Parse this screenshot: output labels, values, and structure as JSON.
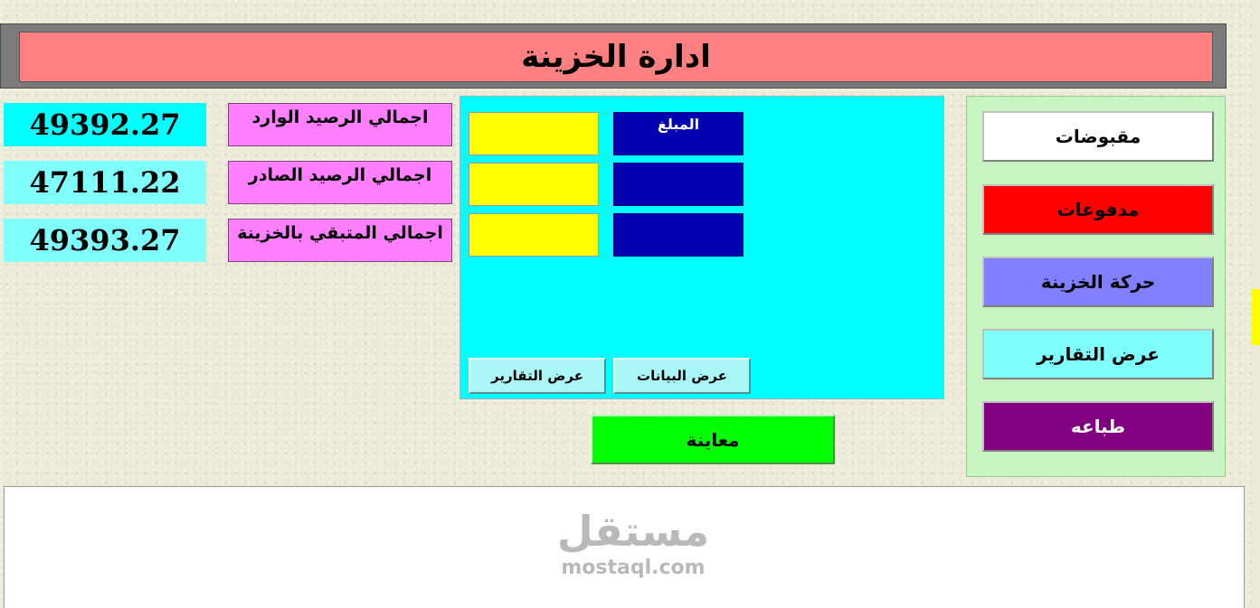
{
  "header": {
    "title": "ادارة الخزينة"
  },
  "menu": [
    {
      "label": "مقبوضات",
      "bg": "#ffffff",
      "color": "#000000"
    },
    {
      "label": "مدفوعات",
      "bg": "#ff0000",
      "color": "#000000"
    },
    {
      "label": "حركة الخزينة",
      "bg": "#8080ff",
      "color": "#000000"
    },
    {
      "label": "عرض التقارير",
      "bg": "#80ffff",
      "color": "#000000"
    },
    {
      "label": "طباعه",
      "bg": "#800080",
      "color": "#ffffff"
    }
  ],
  "center": {
    "amount_label": "المبلغ",
    "show_data_button": "عرض البيانات",
    "show_reports_button": "عرض التقارير"
  },
  "preview_button": "معاينة",
  "totals": [
    {
      "label": "اجمالي الرصيد الوارد",
      "value": "49392.27"
    },
    {
      "label": "اجمالي الرصيد الصادر",
      "value": "47111.22"
    },
    {
      "label": "اجمالي المتبقي بالخزينة",
      "value": "49393.27"
    }
  ],
  "watermark": {
    "arabic": "مستقل",
    "latin": "mostaql.com"
  },
  "colors": {
    "header": "#ff8080",
    "menu_panel": "#c6f5c2",
    "center_panel": "#00ffff",
    "input_yellow": "#ffff00",
    "input_blue": "#0000b0",
    "total_label": "#ff80ff",
    "total_value_first": "#00ffff",
    "total_value": "#80ffff",
    "preview": "#00ff00"
  }
}
